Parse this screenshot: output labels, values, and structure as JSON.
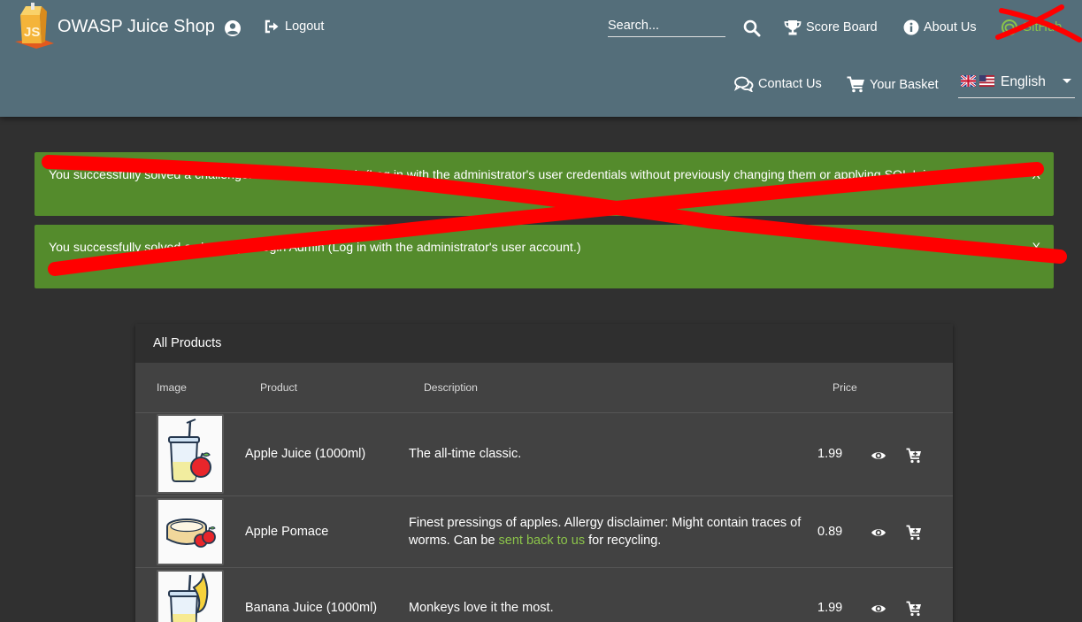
{
  "header": {
    "app_title": "OWASP Juice Shop",
    "logout_label": "Logout",
    "search_placeholder": "Search...",
    "score_board_label": "Score Board",
    "about_label": "About Us",
    "github_label": "GitHub",
    "contact_label": "Contact Us",
    "basket_label": "Your Basket",
    "language": "English",
    "icons": {
      "logo": "juice-shop-logo",
      "account": "account-circle-icon",
      "logout": "logout-icon",
      "search": "search-icon",
      "score_board": "trophy-icon",
      "about": "info-icon",
      "github": "github-icon",
      "contact": "chat-bubbles-icon",
      "basket": "shopping-cart-icon",
      "language": "flag-icons"
    }
  },
  "notifications": [
    {
      "text": "You successfully solved a challenge: Password Strength (Log in with the administrator's user credentials without previously changing them or applying SQL Injection.)",
      "close": "X"
    },
    {
      "text": "You successfully solved a challenge: Login Admin (Log in with the administrator's user account.)",
      "close": "X"
    }
  ],
  "products_table": {
    "title": "All Products",
    "columns": [
      "Image",
      "Product",
      "Description",
      "Price"
    ],
    "rows": [
      {
        "name": "Apple Juice (1000ml)",
        "description": "The all-time classic.",
        "price": "1.99",
        "image_icon": "apple-juice-image"
      },
      {
        "name": "Apple Pomace",
        "description": "Finest pressings of apples. Allergy disclaimer: Might contain traces of worms. Can be ",
        "description_link": "sent back to us",
        "description_suffix": " for recycling.",
        "price": "0.89",
        "image_icon": "apple-pomace-image"
      },
      {
        "name": "Banana Juice (1000ml)",
        "description": "Monkeys love it the most.",
        "price": "1.99",
        "image_icon": "banana-juice-image"
      }
    ],
    "row_action_icons": [
      "eye-icon",
      "add-to-cart-icon"
    ]
  },
  "colors": {
    "toolbar": "#546e7a",
    "background": "#303030",
    "notification": "#548b2c",
    "card": "#424242",
    "accent": "#8bc34a",
    "redaction": "#ff0000"
  }
}
